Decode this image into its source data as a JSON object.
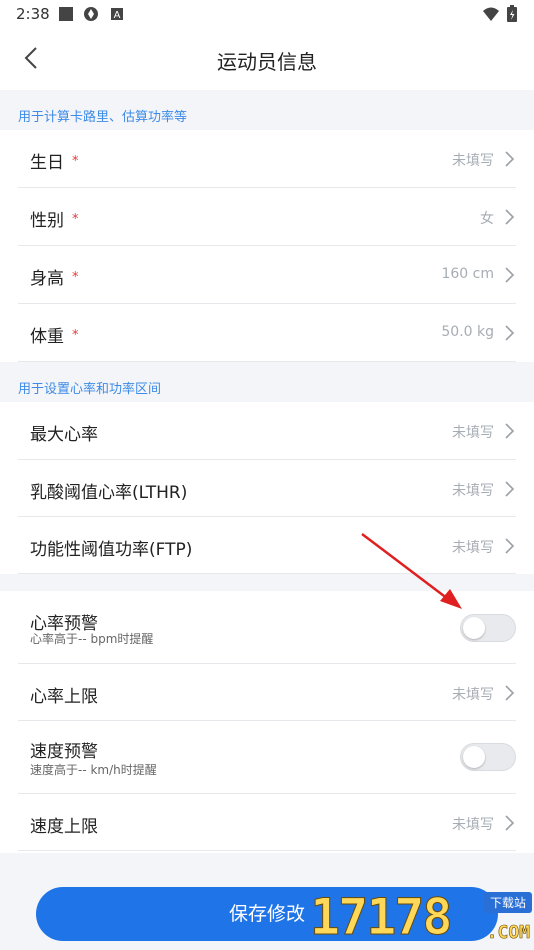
{
  "status_bar": {
    "time": "2:38"
  },
  "header": {
    "title": "运动员信息"
  },
  "section1": {
    "hint": "用于计算卡路里、估算功率等",
    "rows": [
      {
        "label": "生日",
        "required": "*",
        "value": "未填写"
      },
      {
        "label": "性别",
        "required": "*",
        "value": "女"
      },
      {
        "label": "身高",
        "required": "*",
        "value": "160 cm"
      },
      {
        "label": "体重",
        "required": "*",
        "value": "50.0 kg"
      }
    ]
  },
  "section2": {
    "hint": "用于设置心率和功率区间",
    "rows": [
      {
        "label": "最大心率",
        "value": "未填写"
      },
      {
        "label": "乳酸阈值心率(LTHR)",
        "value": "未填写"
      },
      {
        "label": "功能性阈值功率(FTP)",
        "value": "未填写"
      }
    ]
  },
  "section3": {
    "hr_alert": {
      "label": "心率预警",
      "sub": "心率高于-- bpm时提醒",
      "enabled": false
    },
    "hr_limit": {
      "label": "心率上限",
      "value": "未填写"
    },
    "speed_alert": {
      "label": "速度预警",
      "sub": "速度高于-- km/h时提醒",
      "enabled": false
    },
    "speed_limit": {
      "label": "速度上限",
      "value": "未填写"
    }
  },
  "save_button": "保存修改",
  "watermark": {
    "digits": "17178",
    "badge": "下载站",
    "domain": ".COM"
  },
  "colors": {
    "accent": "#1f74e8",
    "hint": "#3d8be8",
    "required": "#e23a3a",
    "annotation_arrow": "#e02020"
  }
}
